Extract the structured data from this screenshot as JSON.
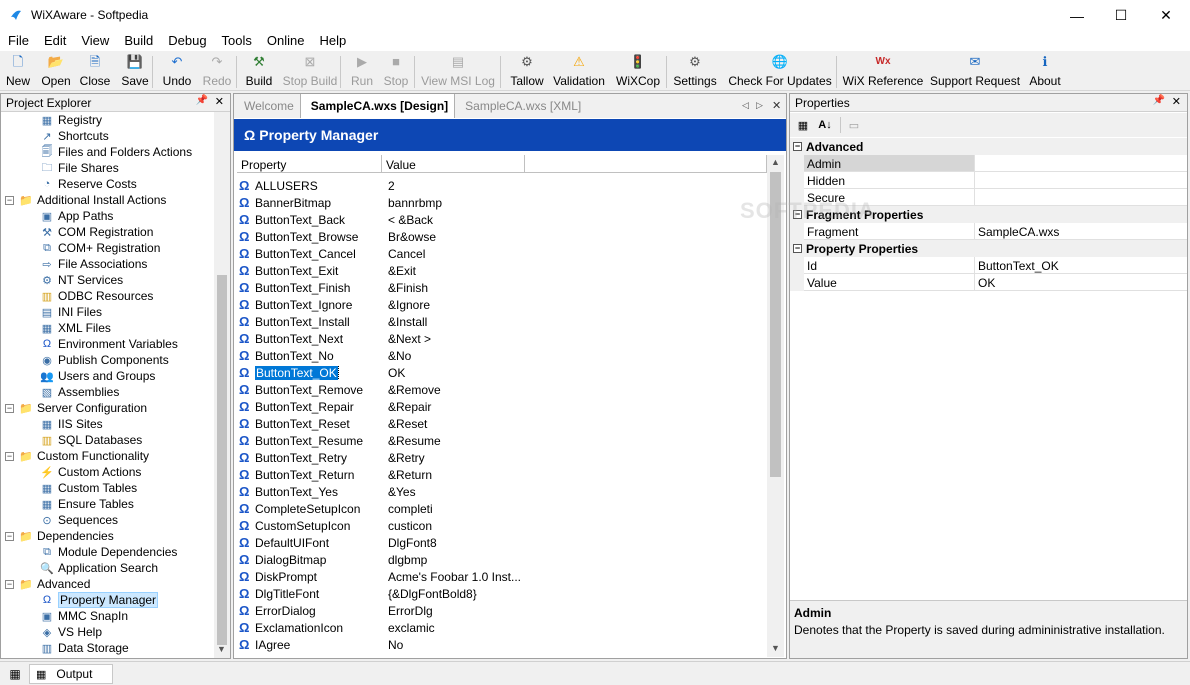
{
  "window": {
    "title": "WiXAware - Softpedia",
    "minimize_glyph": "—",
    "maximize_glyph": "☐",
    "close_glyph": "✕"
  },
  "menu": [
    "File",
    "Edit",
    "View",
    "Build",
    "Debug",
    "Tools",
    "Online",
    "Help"
  ],
  "toolbar": [
    {
      "label": "New",
      "icon": "new-icon",
      "glyph": "🗋",
      "enabled": true
    },
    {
      "label": "Open",
      "icon": "open-icon",
      "glyph": "📂",
      "enabled": true
    },
    {
      "label": "Close",
      "icon": "close-doc-icon",
      "glyph": "🗎",
      "enabled": true
    },
    {
      "label": "Save",
      "icon": "save-icon",
      "glyph": "💾",
      "enabled": true
    },
    {
      "label": "Undo",
      "icon": "undo-icon",
      "glyph": "↶",
      "enabled": true
    },
    {
      "label": "Redo",
      "icon": "redo-icon",
      "glyph": "↷",
      "enabled": false
    },
    {
      "label": "Build",
      "icon": "build-icon",
      "glyph": "⚒",
      "enabled": true
    },
    {
      "label": "Stop Build",
      "icon": "stop-build-icon",
      "glyph": "⊠",
      "enabled": false
    },
    {
      "label": "Run",
      "icon": "run-icon",
      "glyph": "▶",
      "enabled": false
    },
    {
      "label": "Stop",
      "icon": "stop-icon",
      "glyph": "■",
      "enabled": false
    },
    {
      "label": "View MSI Log",
      "icon": "msi-log-icon",
      "glyph": "▤",
      "enabled": false
    },
    {
      "label": "Tallow",
      "icon": "tallow-icon",
      "glyph": "⚙",
      "enabled": true
    },
    {
      "label": "Validation",
      "icon": "validation-icon",
      "glyph": "⚠",
      "enabled": true
    },
    {
      "label": "WiXCop",
      "icon": "traffic-light-icon",
      "glyph": "🚦",
      "enabled": true
    },
    {
      "label": "Settings",
      "icon": "settings-icon",
      "glyph": "⚙",
      "enabled": true
    },
    {
      "label": "Check For Updates",
      "icon": "globe-icon",
      "glyph": "🌐",
      "enabled": true
    },
    {
      "label": "WiX Reference",
      "icon": "wix-reference-icon",
      "glyph": "Wx",
      "enabled": true
    },
    {
      "label": "Support Request",
      "icon": "envelope-icon",
      "glyph": "✉",
      "enabled": true
    },
    {
      "label": "About",
      "icon": "info-icon",
      "glyph": "ℹ",
      "enabled": true
    }
  ],
  "project_explorer": {
    "title": "Project Explorer",
    "pin": "📌",
    "close": "✕",
    "nodes": [
      {
        "label": "Registry",
        "level": 2,
        "icon": "registry-icon",
        "glyph": "▦",
        "expander": ""
      },
      {
        "label": "Shortcuts",
        "level": 2,
        "icon": "shortcut-icon",
        "glyph": "↗",
        "expander": ""
      },
      {
        "label": "Files and Folders Actions",
        "level": 2,
        "icon": "files-icon",
        "glyph": "🗐",
        "expander": ""
      },
      {
        "label": "File Shares",
        "level": 2,
        "icon": "share-icon",
        "glyph": "🗀",
        "expander": ""
      },
      {
        "label": "Reserve Costs",
        "level": 2,
        "icon": "disk-icon",
        "glyph": "◔",
        "expander": ""
      },
      {
        "label": "Additional Install Actions",
        "level": 1,
        "icon": "folder-icon",
        "glyph": "📁",
        "expander": "−"
      },
      {
        "label": "App Paths",
        "level": 2,
        "icon": "app-icon",
        "glyph": "▣",
        "expander": ""
      },
      {
        "label": "COM Registration",
        "level": 2,
        "icon": "tools-icon",
        "glyph": "⚒",
        "expander": ""
      },
      {
        "label": "COM+ Registration",
        "level": 2,
        "icon": "component-icon",
        "glyph": "⧉",
        "expander": ""
      },
      {
        "label": "File Associations",
        "level": 2,
        "icon": "association-icon",
        "glyph": "⇨",
        "expander": ""
      },
      {
        "label": "NT Services",
        "level": 2,
        "icon": "service-icon",
        "glyph": "⚙",
        "expander": ""
      },
      {
        "label": "ODBC Resources",
        "level": 2,
        "icon": "database-icon",
        "glyph": "▥",
        "expander": ""
      },
      {
        "label": "INI Files",
        "level": 2,
        "icon": "ini-icon",
        "glyph": "▤",
        "expander": ""
      },
      {
        "label": "XML Files",
        "level": 2,
        "icon": "xml-icon",
        "glyph": "▦",
        "expander": ""
      },
      {
        "label": "Environment Variables",
        "level": 2,
        "icon": "omega-icon",
        "glyph": "Ω",
        "expander": ""
      },
      {
        "label": "Publish Components",
        "level": 2,
        "icon": "publish-icon",
        "glyph": "◉",
        "expander": ""
      },
      {
        "label": "Users and Groups",
        "level": 2,
        "icon": "users-icon",
        "glyph": "👥",
        "expander": ""
      },
      {
        "label": "Assemblies",
        "level": 2,
        "icon": "assembly-icon",
        "glyph": "▧",
        "expander": ""
      },
      {
        "label": "Server Configuration",
        "level": 1,
        "icon": "folder-icon",
        "glyph": "📁",
        "expander": "−"
      },
      {
        "label": "IIS Sites",
        "level": 2,
        "icon": "iis-icon",
        "glyph": "▦",
        "expander": ""
      },
      {
        "label": "SQL Databases",
        "level": 2,
        "icon": "database-icon",
        "glyph": "▥",
        "expander": ""
      },
      {
        "label": "Custom Functionality",
        "level": 1,
        "icon": "folder-icon",
        "glyph": "📁",
        "expander": "−"
      },
      {
        "label": "Custom Actions",
        "level": 2,
        "icon": "action-icon",
        "glyph": "⚡",
        "expander": ""
      },
      {
        "label": "Custom Tables",
        "level": 2,
        "icon": "table-icon",
        "glyph": "▦",
        "expander": ""
      },
      {
        "label": "Ensure Tables",
        "level": 2,
        "icon": "table-icon",
        "glyph": "▦",
        "expander": ""
      },
      {
        "label": "Sequences",
        "level": 2,
        "icon": "sequence-icon",
        "glyph": "⊙",
        "expander": ""
      },
      {
        "label": "Dependencies",
        "level": 1,
        "icon": "folder-icon",
        "glyph": "📁",
        "expander": "−"
      },
      {
        "label": "Module Dependencies",
        "level": 2,
        "icon": "module-icon",
        "glyph": "⧉",
        "expander": ""
      },
      {
        "label": "Application Search",
        "level": 2,
        "icon": "search-icon",
        "glyph": "🔍",
        "expander": ""
      },
      {
        "label": "Advanced",
        "level": 1,
        "icon": "folder-icon",
        "glyph": "📁",
        "expander": "−"
      },
      {
        "label": "Property Manager",
        "level": 2,
        "icon": "omega-icon",
        "glyph": "Ω",
        "expander": "",
        "selected": true
      },
      {
        "label": "MMC SnapIn",
        "level": 2,
        "icon": "mmc-icon",
        "glyph": "▣",
        "expander": ""
      },
      {
        "label": "VS Help",
        "level": 2,
        "icon": "help-icon",
        "glyph": "◈",
        "expander": ""
      },
      {
        "label": "Data Storage",
        "level": 2,
        "icon": "storage-icon",
        "glyph": "▥",
        "expander": ""
      }
    ]
  },
  "editor": {
    "tabs": [
      {
        "label": "Welcome",
        "active": false
      },
      {
        "label": "SampleCA.wxs [Design]",
        "active": true
      },
      {
        "label": "SampleCA.wxs [XML]",
        "active": false
      }
    ],
    "nav_left": "◁",
    "nav_right": "▷",
    "close": "✕",
    "header": "Property Manager",
    "columns": [
      "Property",
      "Value"
    ],
    "rows": [
      {
        "name": "ALLUSERS",
        "value": "2"
      },
      {
        "name": "BannerBitmap",
        "value": "bannrbmp"
      },
      {
        "name": "ButtonText_Back",
        "value": "< &Back"
      },
      {
        "name": "ButtonText_Browse",
        "value": "Br&owse"
      },
      {
        "name": "ButtonText_Cancel",
        "value": "Cancel"
      },
      {
        "name": "ButtonText_Exit",
        "value": "&Exit"
      },
      {
        "name": "ButtonText_Finish",
        "value": "&Finish"
      },
      {
        "name": "ButtonText_Ignore",
        "value": "&Ignore"
      },
      {
        "name": "ButtonText_Install",
        "value": "&Install"
      },
      {
        "name": "ButtonText_Next",
        "value": "&Next >"
      },
      {
        "name": "ButtonText_No",
        "value": "&No"
      },
      {
        "name": "ButtonText_OK",
        "value": "OK",
        "selected": true
      },
      {
        "name": "ButtonText_Remove",
        "value": "&Remove"
      },
      {
        "name": "ButtonText_Repair",
        "value": "&Repair"
      },
      {
        "name": "ButtonText_Reset",
        "value": "&Reset"
      },
      {
        "name": "ButtonText_Resume",
        "value": "&Resume"
      },
      {
        "name": "ButtonText_Retry",
        "value": "&Retry"
      },
      {
        "name": "ButtonText_Return",
        "value": "&Return"
      },
      {
        "name": "ButtonText_Yes",
        "value": "&Yes"
      },
      {
        "name": "CompleteSetupIcon",
        "value": "completi"
      },
      {
        "name": "CustomSetupIcon",
        "value": "custicon"
      },
      {
        "name": "DefaultUIFont",
        "value": "DlgFont8"
      },
      {
        "name": "DialogBitmap",
        "value": "dlgbmp"
      },
      {
        "name": "DiskPrompt",
        "value": "Acme's Foobar 1.0 Inst..."
      },
      {
        "name": "DlgTitleFont",
        "value": "{&DlgFontBold8}"
      },
      {
        "name": "ErrorDialog",
        "value": "ErrorDlg"
      },
      {
        "name": "ExclamationIcon",
        "value": "exclamic"
      },
      {
        "name": "IAgree",
        "value": "No"
      }
    ]
  },
  "properties": {
    "title": "Properties",
    "pin": "📌",
    "close": "✕",
    "categories": [
      {
        "label": "Advanced",
        "rows": [
          {
            "key": "Admin",
            "value": "",
            "selected": true
          },
          {
            "key": "Hidden",
            "value": ""
          },
          {
            "key": "Secure",
            "value": ""
          }
        ]
      },
      {
        "label": "Fragment Properties",
        "rows": [
          {
            "key": "Fragment",
            "value": "SampleCA.wxs"
          }
        ]
      },
      {
        "label": "Property Properties",
        "rows": [
          {
            "key": "Id",
            "value": "ButtonText_OK"
          },
          {
            "key": "Value",
            "value": "OK"
          }
        ]
      }
    ],
    "description_title": "Admin",
    "description_text": "Denotes that the Property is saved during admininistrative installation."
  },
  "statusbar": {
    "output_label": "Output"
  },
  "watermark": "SOFTPEDIA",
  "colors": {
    "header_blue": "#0d47b4",
    "selection": "#0078d7"
  }
}
